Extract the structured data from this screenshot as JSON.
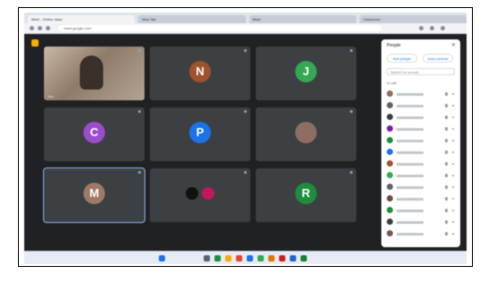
{
  "browser": {
    "tabs": [
      {
        "label": "Meet - Online class"
      },
      {
        "label": "New Tab"
      },
      {
        "label": "Meet"
      },
      {
        "label": "Classroom"
      }
    ],
    "url": "meet.google.com"
  },
  "tiles": [
    {
      "kind": "video",
      "name": "You"
    },
    {
      "kind": "avatar",
      "initial": "N",
      "color": "#a0522d",
      "name": ""
    },
    {
      "kind": "avatar",
      "initial": "J",
      "color": "#34a853",
      "name": ""
    },
    {
      "kind": "avatar",
      "initial": "C",
      "color": "#9c4dcc",
      "name": ""
    },
    {
      "kind": "avatar",
      "initial": "P",
      "color": "#1a73e8",
      "name": ""
    },
    {
      "kind": "photo",
      "initial": "",
      "color": "#8d6e63",
      "name": ""
    },
    {
      "kind": "avatar",
      "initial": "M",
      "color": "#9e7a66",
      "name": ""
    },
    {
      "kind": "pair",
      "initial": "",
      "color": "#c2185b",
      "name": ""
    },
    {
      "kind": "avatar",
      "initial": "R",
      "color": "#1e8e3e",
      "name": ""
    }
  ],
  "panel": {
    "title": "People",
    "add_label": "Add people",
    "host_label": "Host controls",
    "search_placeholder": "Search for people",
    "section_label": "In call",
    "participants": [
      {
        "color": "#8d6e63"
      },
      {
        "color": "#5f6368"
      },
      {
        "color": "#3c4043"
      },
      {
        "color": "#7b1fa2"
      },
      {
        "color": "#1e8e3e"
      },
      {
        "color": "#1a73e8"
      },
      {
        "color": "#a0522d"
      },
      {
        "color": "#34a853"
      },
      {
        "color": "#5f6368"
      },
      {
        "color": "#6d4c41"
      },
      {
        "color": "#1e8e3e"
      },
      {
        "color": "#3c4043"
      },
      {
        "color": "#795548"
      }
    ]
  },
  "bottom": {
    "meeting_info": ""
  },
  "taskbar": {
    "weather": "",
    "clock": ""
  },
  "colors": {
    "stage": "#202124",
    "tile": "#3c4043",
    "end_call": "#ea4335",
    "accent": "#1a73e8"
  }
}
